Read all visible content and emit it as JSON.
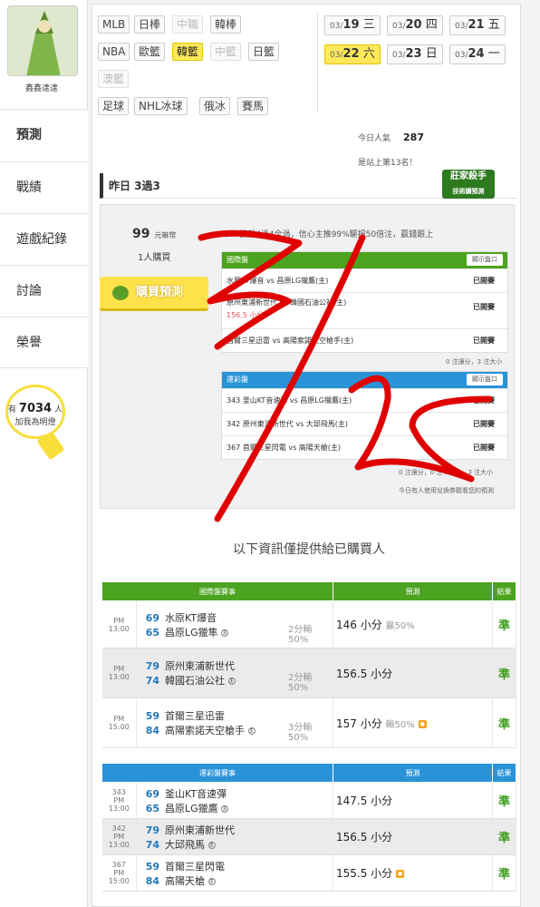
{
  "user": {
    "name": "鑫鑫達達"
  },
  "nav": [
    {
      "label": "預測",
      "active": true
    },
    {
      "label": "戰績"
    },
    {
      "label": "遊戲紀錄"
    },
    {
      "label": "討論"
    },
    {
      "label": "榮譽"
    }
  ],
  "fans": {
    "prefix": "有",
    "count": "7034",
    "suffix": "人",
    "text": "加我為明燈"
  },
  "sports": [
    {
      "label": "MLB",
      "state": "normal"
    },
    {
      "label": "日棒",
      "state": "normal"
    },
    {
      "label": "中職",
      "state": "dim"
    },
    {
      "label": "韓棒",
      "state": "normal"
    },
    {
      "label": "NBA",
      "state": "normal"
    },
    {
      "label": "歐籃",
      "state": "normal"
    },
    {
      "label": "韓籃",
      "state": "selected"
    },
    {
      "label": "中籃",
      "state": "dim"
    },
    {
      "label": "日籃",
      "state": "normal"
    },
    {
      "label": "澳籃",
      "state": "dim"
    },
    {
      "label": "足球",
      "state": "normal"
    },
    {
      "label": "NHL冰球",
      "state": "normal"
    },
    {
      "label": "俄冰",
      "state": "normal"
    },
    {
      "label": "賽馬",
      "state": "normal"
    }
  ],
  "dates": [
    {
      "md": "03/",
      "d": "19",
      "wd": "三"
    },
    {
      "md": "03/",
      "d": "20",
      "wd": "四"
    },
    {
      "md": "03/",
      "d": "21",
      "wd": "五"
    },
    {
      "md": "03/",
      "d": "22",
      "wd": "六",
      "selected": true
    },
    {
      "md": "03/",
      "d": "23",
      "wd": "日"
    },
    {
      "md": "03/",
      "d": "24",
      "wd": "一"
    }
  ],
  "popularity": {
    "label": "今日人氣",
    "value": "287"
  },
  "rank": {
    "text": "是站上第13名！"
  },
  "yesterday": {
    "label": "昨日 3過3"
  },
  "killer_badge": {
    "line1": "莊家殺手",
    "line2": "技術讀預測"
  },
  "promo": {
    "price": "99",
    "price_unit": "元嘛幣",
    "buyers": "1人購買",
    "buy_button": "購買預測",
    "description": "3/17雙盤4過4全過，信心主推99%驅揚50倍注，贏錢跟上",
    "intl_header": "國際盤",
    "show_btn": "顯示盤口",
    "intl_rows": [
      {
        "text": "水原KT爆音 vs 昌原LG獵鷹(主)",
        "status": "已開賽"
      },
      {
        "text": "原州東浦新世代 vs 韓國石油公社(主)",
        "extra": "156.5 小分",
        "status": "已開賽"
      },
      {
        "text": "首爾三星迅雷 vs 高陽索諾天空槍手(主)",
        "status": "已開賽"
      }
    ],
    "intl_foot": "0 注讓分，3 注大小",
    "lottery_header": "運彩盤",
    "lottery_rows": [
      {
        "text": "343 釜山KT音速彈 vs 昌原LG獵鷹(主)",
        "status": "已開賽"
      },
      {
        "text": "342 原州東浦新世代 vs 大邱飛馬(主)",
        "status": "已開賽"
      },
      {
        "text": "367 首爾三星閃電 vs 高陽天槍(主)",
        "status": "已開賽"
      }
    ],
    "lottery_foot": "0 注讓分，0 注不讓分，3 注大小",
    "redeem_note": "今日有人使用兌換券觀看您的預測"
  },
  "info_text": "以下資訊僅提供給已購買人",
  "intl_table": {
    "headers": [
      "國際盤賽事",
      "預測",
      "結果"
    ],
    "rows": [
      {
        "time": "PM 13:00",
        "s1": "69",
        "t1": "水原KT爆音",
        "s2": "65",
        "t2": "昌原LG獵隼",
        "spread": "2分輸",
        "pct": "50%",
        "pred": "146 小分",
        "pred_note": "贏50%",
        "result": "準"
      },
      {
        "time": "PM 13:00",
        "s1": "79",
        "t1": "原州東浦新世代",
        "s2": "74",
        "t2": "韓國石油公社",
        "spread": "2分輸",
        "pct": "50%",
        "pred": "156.5 小分",
        "pred_note": "",
        "result": "準"
      },
      {
        "time": "PM 15:00",
        "s1": "59",
        "t1": "首爾三星迅雷",
        "s2": "84",
        "t2": "高陽索諾天空槍手",
        "spread": "3分輸",
        "pct": "50%",
        "pred": "157 小分",
        "pred_note": "輸50%",
        "result": "準"
      }
    ]
  },
  "lottery_table": {
    "headers": [
      "運彩盤賽事",
      "預測",
      "結果"
    ],
    "rows": [
      {
        "no": "343",
        "time": "PM 13:00",
        "s1": "69",
        "t1": "釜山KT音速彈",
        "s2": "65",
        "t2": "昌原LG獵鷹",
        "pred": "147.5 小分",
        "result": "準"
      },
      {
        "no": "342",
        "time": "PM 13:00",
        "s1": "79",
        "t1": "原州東浦新世代",
        "s2": "74",
        "t2": "大邱飛馬",
        "pred": "156.5 小分",
        "result": "準"
      },
      {
        "no": "367",
        "time": "PM 15:00",
        "s1": "59",
        "t1": "首爾三星閃電",
        "s2": "84",
        "t2": "高陽天槍",
        "pred": "155.5 小分",
        "result": "準"
      }
    ]
  },
  "home_mark": "主",
  "colors": {
    "green": "#4ca31f",
    "blue": "#2a93d8",
    "yellow": "#ffe95b",
    "result": "#3d9c1c",
    "ink": "#e00000"
  }
}
